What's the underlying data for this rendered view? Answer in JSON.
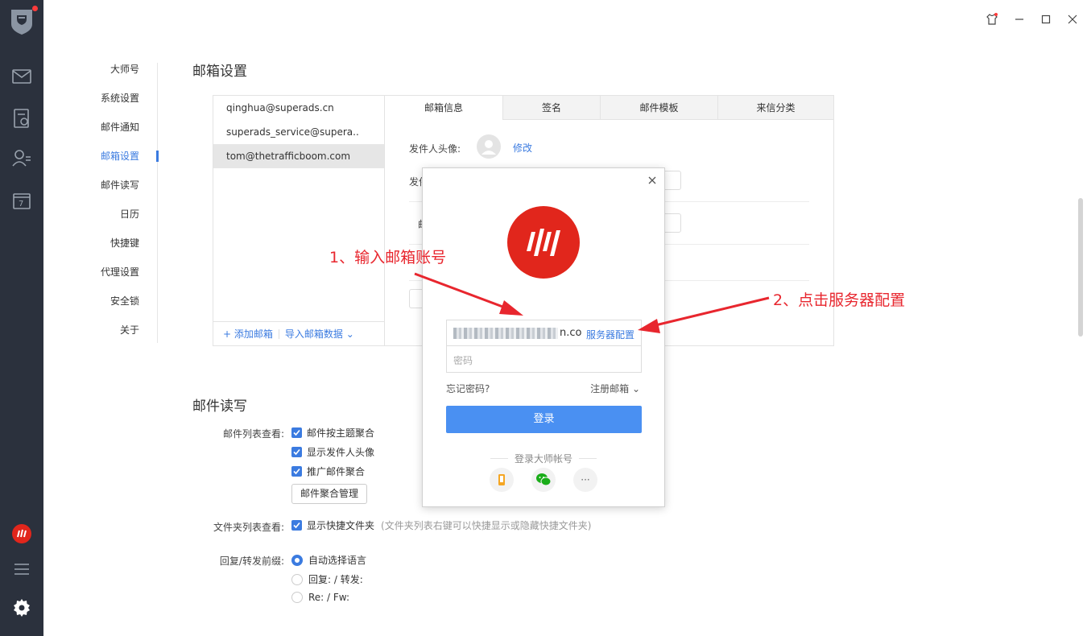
{
  "sidebar": {
    "icons": [
      "avatar-icon",
      "mail-icon",
      "notes-icon",
      "contacts-icon",
      "calendar-icon",
      "brand-logo-icon",
      "menu-icon",
      "settings-icon"
    ],
    "calendar_day": "7"
  },
  "settings_menu": {
    "items": [
      {
        "label": "大师号"
      },
      {
        "label": "系统设置"
      },
      {
        "label": "邮件通知"
      },
      {
        "label": "邮箱设置",
        "active": true
      },
      {
        "label": "邮件读写"
      },
      {
        "label": "日历"
      },
      {
        "label": "快捷键"
      },
      {
        "label": "代理设置"
      },
      {
        "label": "安全锁"
      },
      {
        "label": "关于"
      }
    ]
  },
  "mailbox_settings": {
    "title": "邮箱设置",
    "accounts": [
      "qinghua@superads.cn",
      "superads_service@supera..",
      "tom@thetrafficboom.com"
    ],
    "selected_account": 2,
    "add_mailbox": "+ 添加邮箱",
    "import_mailbox": "导入邮箱数据 ⌄",
    "tabs": [
      "邮箱信息",
      "签名",
      "邮件模板",
      "来信分类"
    ],
    "sender_avatar_label": "发件人头像:",
    "modify_link": "修改",
    "partial_label_1": "发件",
    "partial_label_2": "邮"
  },
  "mail_rw": {
    "title": "邮件读写",
    "list_view_label": "邮件列表查看:",
    "checks": [
      "邮件按主题聚合",
      "显示发件人头像",
      "推广邮件聚合"
    ],
    "aggregate_btn": "邮件聚合管理",
    "folder_label": "文件夹列表查看:",
    "folder_check": "显示快捷文件夹",
    "folder_hint": "(文件夹列表右键可以快捷显示或隐藏快捷文件夹)",
    "prefix_label": "回复/转发前缀:",
    "prefix_options": [
      "自动选择语言",
      "回复: / 转发:",
      "Re: / Fw:"
    ]
  },
  "login_dialog": {
    "account_tail": "n.co",
    "server_config": "服务器配置",
    "password_placeholder": "密码",
    "forgot": "忘记密码?",
    "register": "注册邮箱 ⌄",
    "login_btn": "登录",
    "master_login": "登录大师帐号",
    "more": "···"
  },
  "annotations": {
    "step1": "1、输入邮箱账号",
    "step2": "2、点击服务器配置"
  },
  "colors": {
    "accent": "#3b7be0",
    "annotation": "#e8262e",
    "brand": "#e1261c",
    "rail": "#2b313d"
  }
}
